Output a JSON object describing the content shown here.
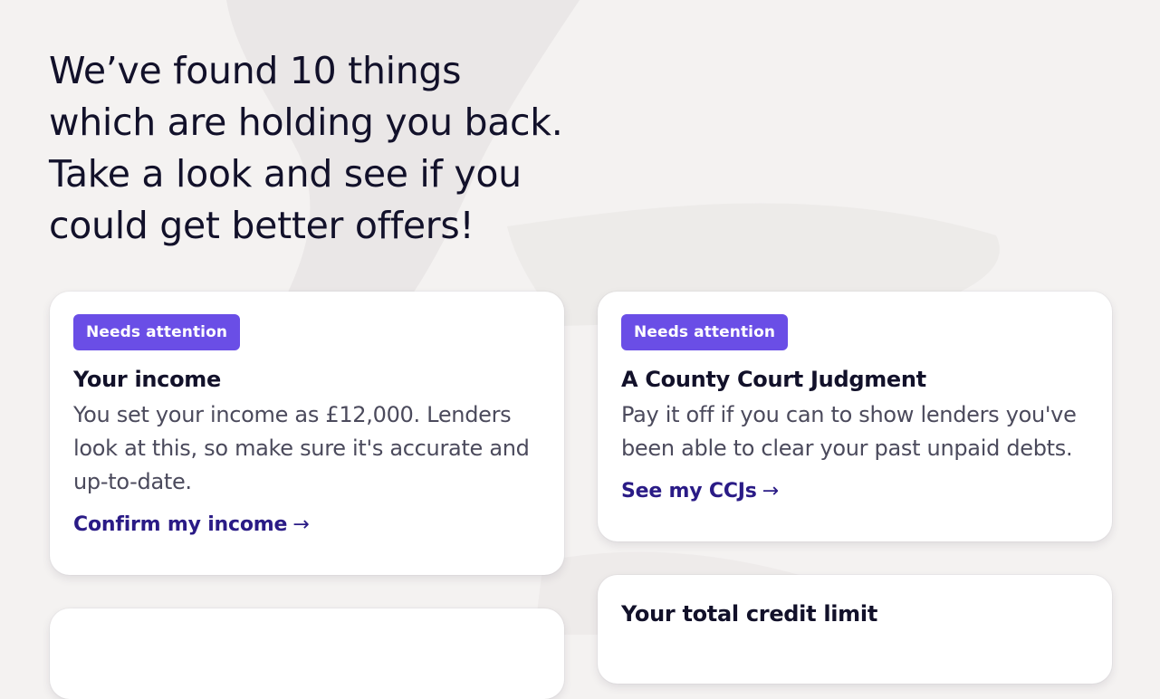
{
  "hero": {
    "headline": "We’ve found 10 things\nwhich are holding you back.\nTake a look and see if you\ncould get better offers!"
  },
  "cards": [
    {
      "badge": "Needs attention",
      "title": "Your income",
      "body": "You set your income as £12,000. Lenders look at this, so make sure it's accurate and up-to-date.",
      "link": "Confirm my income",
      "link_icon": "arrow-right-icon"
    },
    {
      "badge": "Needs attention",
      "title": "A County Court Judgment",
      "body": "Pay it off if you can to show lenders you've been able to clear your past unpaid debts.",
      "link": "See my CCJs",
      "link_icon": "arrow-right-icon"
    },
    {
      "title": "Your total credit limit"
    }
  ],
  "colors": {
    "background": "#f4f2f1",
    "card": "#ffffff",
    "badge": "#6a4ee6",
    "link": "#2a1b86",
    "text": "#12112a",
    "muted_text": "#4b4a5c"
  }
}
